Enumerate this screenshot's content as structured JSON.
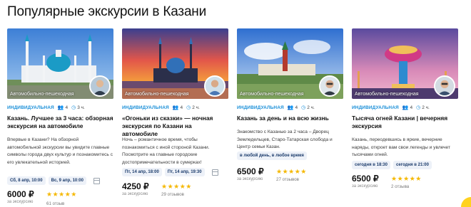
{
  "page": {
    "title": "Популярные экскурсии в Казани"
  },
  "cards": [
    {
      "photo_label": "Автомобильно-пешеходная",
      "type": "ИНДИВИДУАЛЬНАЯ",
      "people": "4",
      "duration": "3 ч.",
      "title": "Казань. Лучшее за 3 часа: обзорная экскурсия на автомобиле",
      "description": "Впервые в Казани? На обзорной автомобильной экскурсии вы увидите главные символы города двух культур и познакомитесь с его увлекательной историей.",
      "dates": [
        "Сб, 8 апр, 10:00",
        "Вс, 9 апр, 10:00"
      ],
      "price": "6000 ₽",
      "price_note": "за экскурсию",
      "rating": 5,
      "stars": "★★★★★",
      "reviews": "61 отзыв"
    },
    {
      "photo_label": "Автомобильно-пешеходная",
      "type": "ИНДИВИДУАЛЬНАЯ",
      "people": "4",
      "duration": "2 ч.",
      "title": "«Огоньки из сказки» — ночная экскурсия по Казани на автомобиле",
      "description": "Ночь – романтичное время, чтобы познакомиться с иной стороной Казани. Посмотрите на главные городские достопримечательности в сумерках!",
      "dates": [
        "Пт, 14 апр, 18:00",
        "Пт, 14 апр, 19:30"
      ],
      "price": "4250 ₽",
      "price_note": "за экскурсию",
      "rating": 5,
      "stars": "★★★★★",
      "reviews": "29 отзывов"
    },
    {
      "photo_label": "Автомобильно-пешеходная",
      "type": "ИНДИВИДУАЛЬНАЯ",
      "people": "4",
      "duration": "2 ч.",
      "title": "Казань за день и на всю жизнь",
      "description": "Знакомство с Казанью за 2 часа – Дворец Земледельцев, Старо-Татарская слобода и Центр семьи Казан.",
      "dates": [
        "в любой день, в любое время"
      ],
      "price": "6500 ₽",
      "price_note": "за экскурсию",
      "rating": 5,
      "stars": "★★★★★",
      "reviews": "27 отзывов"
    },
    {
      "photo_label": "Автомобильно-пешеходная",
      "type": "ИНДИВИДУАЛЬНАЯ",
      "people": "4",
      "duration": "2 ч.",
      "title": "Тысяча огней Казани | вечерняя экскурсия",
      "description": "Казань, переодевшись в яркие, вечерние наряды, откроет вам свои легенды и увлечет тысячами огней.",
      "dates": [
        "сегодня в 18:30",
        "сегодня в 21:00"
      ],
      "price": "6500 ₽",
      "price_note": "за экскурсию",
      "rating": 5,
      "stars": "★★★★★",
      "reviews": "2 отзыва"
    }
  ],
  "colors": {
    "accent": "#1a8fd8",
    "star": "#f5b800",
    "chip_bg": "#edf1f8",
    "brand_blob": "#ffd21f"
  },
  "icons": {
    "people": "people-icon",
    "duration": "clock-icon",
    "calendar": "calendar-icon"
  }
}
